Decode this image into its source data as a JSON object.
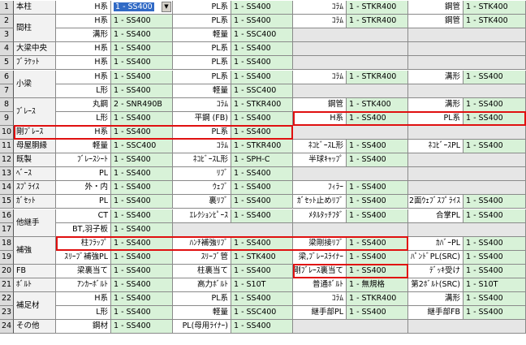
{
  "rows": [
    {
      "n": "1",
      "cat": "本柱",
      "cells": [
        [
          "H系",
          "1 - SS400"
        ],
        [
          "PL系",
          "1 - SS400"
        ],
        [
          "ｺﾗﾑ",
          "1 - STKR400"
        ],
        [
          "鋼管",
          "1 - STK400"
        ]
      ]
    },
    {
      "n": "2",
      "cat": "間柱",
      "cells": [
        [
          "H系",
          "1 - SS400"
        ],
        [
          "PL系",
          "1 - SS400"
        ],
        [
          "ｺﾗﾑ",
          "1 - STKR400"
        ],
        [
          "鋼管",
          "1 - STK400"
        ]
      ]
    },
    {
      "n": "3",
      "cat": "",
      "cells": [
        [
          "溝形",
          "1 - SS400"
        ],
        [
          "軽量",
          "1 - SSC400"
        ],
        null,
        null
      ]
    },
    {
      "n": "4",
      "cat": "大梁中央",
      "cells": [
        [
          "H系",
          "1 - SS400"
        ],
        [
          "PL系",
          "1 - SS400"
        ],
        null,
        null
      ]
    },
    {
      "n": "5",
      "cat": "ﾌﾞﾗｹｯﾄ",
      "cells": [
        [
          "H系",
          "1 - SS400"
        ],
        [
          "PL系",
          "1 - SS400"
        ],
        null,
        null
      ]
    },
    {
      "n": "6",
      "cat": "小梁",
      "cells": [
        [
          "H系",
          "1 - SS400"
        ],
        [
          "PL系",
          "1 - SS400"
        ],
        [
          "ｺﾗﾑ",
          "1 - STKR400"
        ],
        [
          "溝形",
          "1 - SS400"
        ]
      ]
    },
    {
      "n": "7",
      "cat": "",
      "cells": [
        [
          "L形",
          "1 - SS400"
        ],
        [
          "軽量",
          "1 - SSC400"
        ],
        null,
        null
      ]
    },
    {
      "n": "8",
      "cat": "ﾌﾞﾚｰｽ",
      "cells": [
        [
          "丸鋼",
          "2 - SNR490B"
        ],
        [
          "ｺﾗﾑ",
          "1 - STKR400"
        ],
        [
          "鋼管",
          "1 - STK400"
        ],
        [
          "溝形",
          "1 - SS400"
        ]
      ]
    },
    {
      "n": "9",
      "cat": "",
      "cells": [
        [
          "L形",
          "1 - SS400"
        ],
        [
          "平鋼 (FB)",
          "1 - SS400"
        ],
        [
          "H系",
          "1 - SS400"
        ],
        [
          "PL系",
          "1 - SS400"
        ]
      ]
    },
    {
      "n": "10",
      "cat": "剛ﾌﾞﾚｰｽ",
      "cells": [
        [
          "H系",
          "1 - SS400"
        ],
        [
          "PL系",
          "1 - SS400"
        ],
        null,
        null
      ]
    },
    {
      "n": "11",
      "cat": "母屋胴縁",
      "cells": [
        [
          "軽量",
          "1 - SSC400"
        ],
        [
          "ｺﾗﾑ",
          "1 - STKR400"
        ],
        [
          "ﾈｺﾋﾞｰｽL形",
          "1 - SS400"
        ],
        [
          "ﾈｺﾋﾞｰｽPL",
          "1 - SS400"
        ]
      ]
    },
    {
      "n": "12",
      "cat": "既製",
      "cells": [
        [
          "ﾌﾞﾚｰｽｼｰﾄ",
          "1 - SS400"
        ],
        [
          "ﾈｺﾋﾞｰｽL形",
          "1 - SPH-C"
        ],
        [
          "半球ｷｬｯﾌﾟ",
          "1 - SS400"
        ],
        null
      ]
    },
    {
      "n": "13",
      "cat": "ﾍﾞｰｽ",
      "cells": [
        [
          "PL",
          "1 - SS400"
        ],
        [
          "ﾘﾌﾞ",
          "1 - SS400"
        ],
        null,
        null
      ]
    },
    {
      "n": "14",
      "cat": "ｽﾌﾟﾗｲｽ",
      "cells": [
        [
          "外・内",
          "1 - SS400"
        ],
        [
          "ｳｪﾌﾞ",
          "1 - SS400"
        ],
        [
          "ﾌｨﾗｰ",
          "1 - SS400"
        ],
        null
      ]
    },
    {
      "n": "15",
      "cat": "ｶﾞｾｯﾄ",
      "cells": [
        [
          "PL",
          "1 - SS400"
        ],
        [
          "裏ﾘﾌﾞ",
          "1 - SS400"
        ],
        [
          "ｶﾞｾｯﾄ止めﾘﾌﾞ",
          "1 - SS400"
        ],
        [
          "2面ｳｪﾌﾞｽﾌﾟﾗｲｽ",
          "1 - SS400"
        ]
      ]
    },
    {
      "n": "16",
      "cat": "他継手",
      "cells": [
        [
          "CT",
          "1 - SS400"
        ],
        [
          "ｴﾚｸｼｮﾝﾋﾟｰｽ",
          "1 - SS400"
        ],
        [
          "ﾒﾀﾙﾀｯﾁﾌﾀﾞ",
          "1 - SS400"
        ],
        [
          "合掌PL",
          "1 - SS400"
        ]
      ]
    },
    {
      "n": "17",
      "cat": "",
      "cells": [
        [
          "BT,羽子板",
          "1 - SS400"
        ],
        null,
        null,
        null
      ]
    },
    {
      "n": "18",
      "cat": "補強",
      "cells": [
        [
          "柱ﾌﾗｯﾌﾟ",
          "1 - SS400"
        ],
        [
          "ﾊﾝﾁ補強ﾘﾌﾞ",
          "1 - SS400"
        ],
        [
          "梁剛接ﾘﾌﾞ",
          "1 - SS400"
        ],
        [
          "ｶﾊﾞｰPL",
          "1 - SS400"
        ]
      ]
    },
    {
      "n": "19",
      "cat": "",
      "cells": [
        [
          "ｽﾘｰﾌﾞ補強PL",
          "1 - SS400"
        ],
        [
          "ｽﾘｰﾌﾞ管",
          "1 - STK400"
        ],
        [
          "梁,ﾌﾞﾚｰｽﾗｲﾅｰ",
          "1 - SS400"
        ],
        [
          "ﾊﾟﾝﾄﾞPL(SRC)",
          "1 - SS400"
        ]
      ]
    },
    {
      "n": "20",
      "cat": "FB",
      "cells": [
        [
          "梁裏当て",
          "1 - SS400"
        ],
        [
          "柱裏当て",
          "1 - SS400"
        ],
        [
          "剛ﾌﾞﾚｰｽ裏当て",
          "1 - SS400"
        ],
        [
          "ﾃﾞｯｷ受け",
          "1 - SS400"
        ]
      ]
    },
    {
      "n": "21",
      "cat": "ﾎﾞﾙﾄ",
      "cells": [
        [
          "ｱﾝｶｰﾎﾞﾙﾄ",
          "1 - SS400"
        ],
        [
          "高力ﾎﾞﾙﾄ",
          "1 - S10T"
        ],
        [
          "普通ﾎﾞﾙﾄ",
          "1 - 無規格"
        ],
        [
          "第2ﾎﾞﾙﾄ(SRC)",
          "1 - S10T"
        ]
      ]
    },
    {
      "n": "22",
      "cat": "補足材",
      "cells": [
        [
          "H系",
          "1 - SS400"
        ],
        [
          "PL系",
          "1 - SS400"
        ],
        [
          "ｺﾗﾑ",
          "1 - STKR400"
        ],
        [
          "溝形",
          "1 - SS400"
        ]
      ]
    },
    {
      "n": "23",
      "cat": "",
      "cells": [
        [
          "L形",
          "1 - SS400"
        ],
        [
          "軽量",
          "1 - SSC400"
        ],
        [
          "継手部PL",
          "1 - SS400"
        ],
        [
          "継手部FB",
          "1 - SS400"
        ]
      ]
    },
    {
      "n": "24",
      "cat": "その他",
      "cells": [
        [
          "鋼材",
          "1 - SS400"
        ],
        [
          "PL(母用ﾗｲﾅｰ)",
          "1 - SS400"
        ],
        null,
        null
      ]
    }
  ],
  "colors": {
    "value_bg": "#d8f2d8",
    "row_header_bg": "#dcdcdc",
    "highlight": "#e01010"
  }
}
